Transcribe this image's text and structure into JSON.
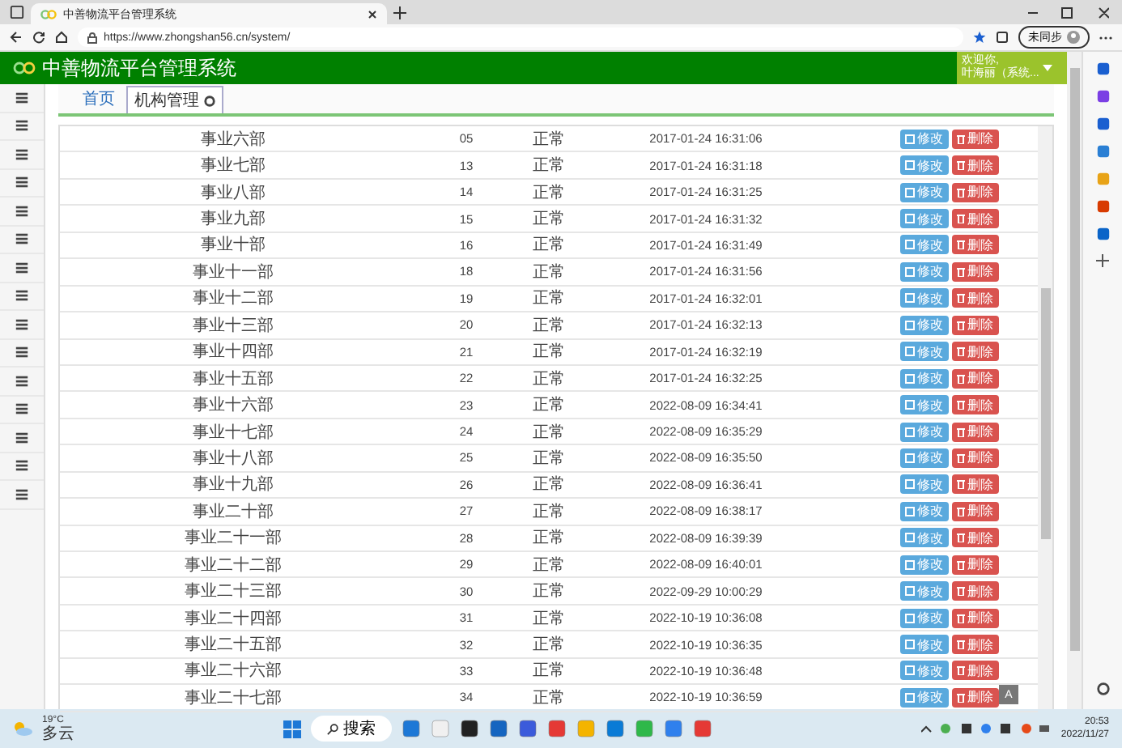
{
  "browser": {
    "tab_title": "中善物流平台管理系统",
    "url": "https://www.zhongshan56.cn/system/",
    "sync_label": "未同步"
  },
  "header": {
    "title": "中善物流平台管理系统",
    "user_greeting": "欢迎你,",
    "user_name": "叶海丽（系统..."
  },
  "tabs": [
    {
      "label": "首页",
      "selected": false,
      "closable": false
    },
    {
      "label": "机构管理",
      "selected": true,
      "closable": true
    }
  ],
  "table": {
    "rows": [
      {
        "name": "事业六部",
        "code": "05",
        "status": "正常",
        "created": "2017-01-24 16:31:06",
        "actions": [
          "修改",
          "删除"
        ]
      },
      {
        "name": "事业七部",
        "code": "13",
        "status": "正常",
        "created": "2017-01-24 16:31:18",
        "actions": [
          "修改",
          "删除"
        ]
      },
      {
        "name": "事业八部",
        "code": "14",
        "status": "正常",
        "created": "2017-01-24 16:31:25",
        "actions": [
          "修改",
          "删除"
        ]
      },
      {
        "name": "事业九部",
        "code": "15",
        "status": "正常",
        "created": "2017-01-24 16:31:32",
        "actions": [
          "修改",
          "删除"
        ]
      },
      {
        "name": "事业十部",
        "code": "16",
        "status": "正常",
        "created": "2017-01-24 16:31:49",
        "actions": [
          "修改",
          "删除"
        ]
      },
      {
        "name": "事业十一部",
        "code": "18",
        "status": "正常",
        "created": "2017-01-24 16:31:56",
        "actions": [
          "修改",
          "删除"
        ]
      },
      {
        "name": "事业十二部",
        "code": "19",
        "status": "正常",
        "created": "2017-01-24 16:32:01",
        "actions": [
          "修改",
          "删除"
        ]
      },
      {
        "name": "事业十三部",
        "code": "20",
        "status": "正常",
        "created": "2017-01-24 16:32:13",
        "actions": [
          "修改",
          "删除"
        ]
      },
      {
        "name": "事业十四部",
        "code": "21",
        "status": "正常",
        "created": "2017-01-24 16:32:19",
        "actions": [
          "修改",
          "删除"
        ]
      },
      {
        "name": "事业十五部",
        "code": "22",
        "status": "正常",
        "created": "2017-01-24 16:32:25",
        "actions": [
          "修改",
          "删除"
        ]
      },
      {
        "name": "事业十六部",
        "code": "23",
        "status": "正常",
        "created": "2022-08-09 16:34:41",
        "actions": [
          "修改",
          "删除"
        ]
      },
      {
        "name": "事业十七部",
        "code": "24",
        "status": "正常",
        "created": "2022-08-09 16:35:29",
        "actions": [
          "修改",
          "删除"
        ]
      },
      {
        "name": "事业十八部",
        "code": "25",
        "status": "正常",
        "created": "2022-08-09 16:35:50",
        "actions": [
          "修改",
          "删除"
        ]
      },
      {
        "name": "事业十九部",
        "code": "26",
        "status": "正常",
        "created": "2022-08-09 16:36:41",
        "actions": [
          "修改",
          "删除"
        ]
      },
      {
        "name": "事业二十部",
        "code": "27",
        "status": "正常",
        "created": "2022-08-09 16:38:17",
        "actions": [
          "修改",
          "删除"
        ]
      },
      {
        "name": "事业二十一部",
        "code": "28",
        "status": "正常",
        "created": "2022-08-09 16:39:39",
        "actions": [
          "修改",
          "删除"
        ]
      },
      {
        "name": "事业二十二部",
        "code": "29",
        "status": "正常",
        "created": "2022-08-09 16:40:01",
        "actions": [
          "修改",
          "删除"
        ]
      },
      {
        "name": "事业二十三部",
        "code": "30",
        "status": "正常",
        "created": "2022-09-29 10:00:29",
        "actions": [
          "修改",
          "删除"
        ]
      },
      {
        "name": "事业二十四部",
        "code": "31",
        "status": "正常",
        "created": "2022-10-19 10:36:08",
        "actions": [
          "修改",
          "删除"
        ]
      },
      {
        "name": "事业二十五部",
        "code": "32",
        "status": "正常",
        "created": "2022-10-19 10:36:35",
        "actions": [
          "修改",
          "删除"
        ]
      },
      {
        "name": "事业二十六部",
        "code": "33",
        "status": "正常",
        "created": "2022-10-19 10:36:48",
        "actions": [
          "修改",
          "删除"
        ]
      },
      {
        "name": "事业二十七部",
        "code": "34",
        "status": "正常",
        "created": "2022-10-19 10:36:59",
        "actions": [
          "修改",
          "删除"
        ]
      }
    ]
  },
  "float_button": "A",
  "taskbar": {
    "weather_temp": "19°C",
    "weather_desc": "多云",
    "search": "搜索",
    "time": "20:53",
    "date": "2022/11/27"
  }
}
